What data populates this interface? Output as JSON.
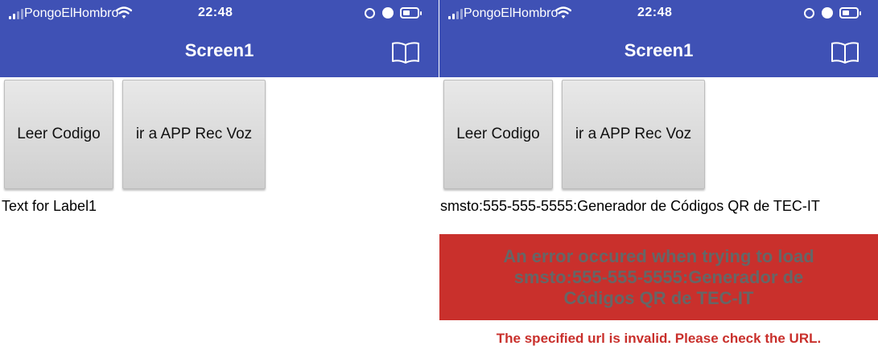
{
  "status": {
    "carrier": "PongoElHombro",
    "time": "22:48"
  },
  "app": {
    "title": "Screen1"
  },
  "buttons": {
    "leer_codigo": "Leer Codigo",
    "ir_app": "ir a APP Rec Voz"
  },
  "left_screen": {
    "label1": "Text for Label1"
  },
  "right_screen": {
    "label1": "smsto:555-555-5555:Generador de Códigos QR de TEC-IT",
    "error_title": "An error occured when trying to load smsto:555-555-5555:Generador de Códigos QR de TEC-IT",
    "error_detail": "The specified url is invalid. Please check the URL."
  },
  "colors": {
    "app_bar": "#3f51b5",
    "error": "#c9302c",
    "error_text": "#666666"
  }
}
